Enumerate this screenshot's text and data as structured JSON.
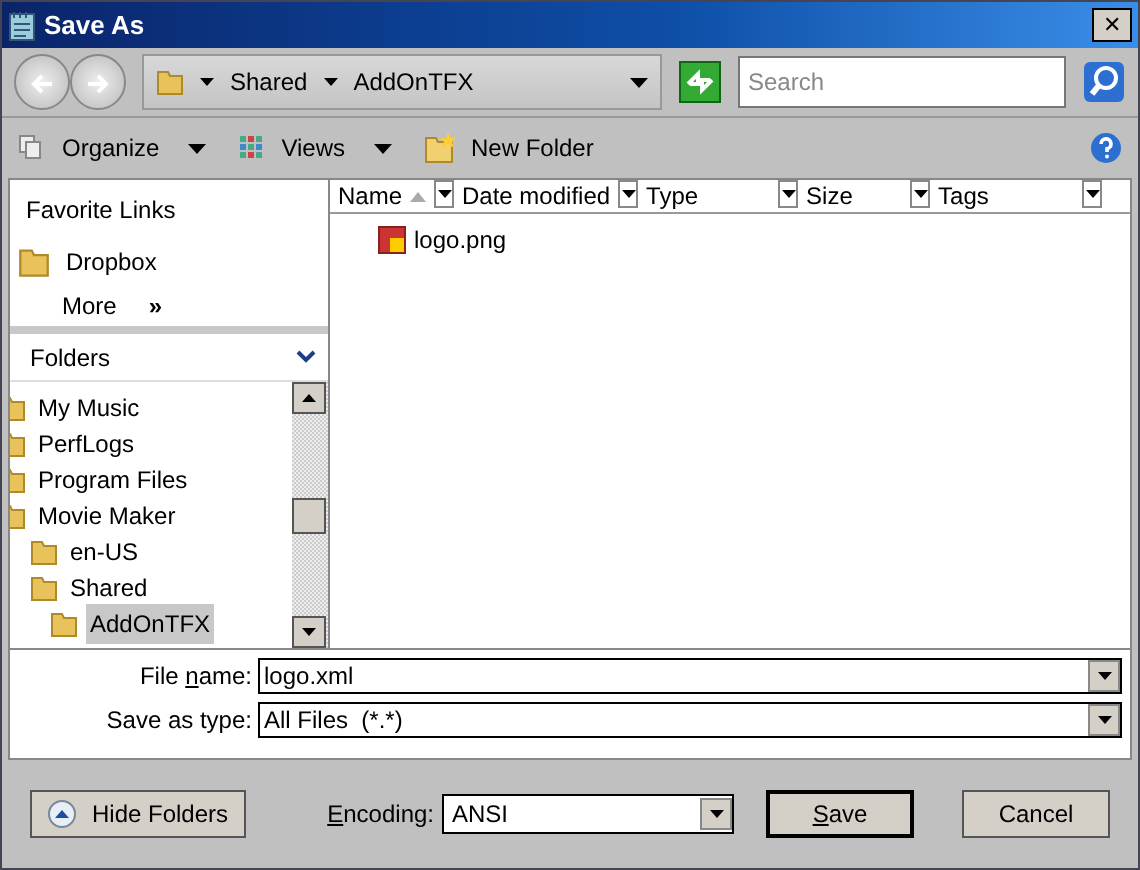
{
  "window": {
    "title": "Save As",
    "close": "✕"
  },
  "address_bar": {
    "segments": [
      "Shared",
      "AddOnTFX"
    ],
    "search": {
      "placeholder": "Search"
    }
  },
  "toolbar": {
    "items": [
      {
        "kind": "organize",
        "label": "Organize"
      },
      {
        "kind": "views",
        "label": "Views"
      },
      {
        "kind": "newfolder",
        "label": "New Folder"
      }
    ]
  },
  "favorite_links": {
    "title": "Favorite Links",
    "items": [
      {
        "label": "Dropbox"
      }
    ],
    "more": "More",
    "more_glyph": "»"
  },
  "folders": {
    "title": "Folders",
    "tree": [
      {
        "label": "My Music",
        "selected": false
      },
      {
        "label": "PerfLogs",
        "selected": false
      },
      {
        "label": "Program Files",
        "selected": false
      },
      {
        "label": "Movie Maker",
        "selected": false,
        "children": [
          {
            "label": "en-US",
            "selected": false
          },
          {
            "label": "Shared",
            "selected": false,
            "children": [
              {
                "label": "AddOnTFX",
                "selected": true
              }
            ]
          }
        ]
      }
    ]
  },
  "file_list": {
    "columns": [
      {
        "label": "Name",
        "sorted": true
      },
      {
        "label": "Date modified",
        "sorted": false
      },
      {
        "label": "Type",
        "sorted": false
      },
      {
        "label": "Size",
        "sorted": false
      },
      {
        "label": "Tags",
        "sorted": false
      }
    ],
    "files": [
      {
        "name": "logo.png"
      }
    ]
  },
  "fields": [
    {
      "label": [
        {
          "kind": "plain",
          "text": "File "
        },
        {
          "kind": "key",
          "text": "n"
        },
        {
          "kind": "plain",
          "text": "ame:"
        }
      ],
      "value": "logo.xml"
    },
    {
      "label": [
        {
          "kind": "plain",
          "text": "Save as type:"
        }
      ],
      "value": "All Files  (*.*)"
    }
  ],
  "bottom": {
    "hide_folders": "Hide Folders",
    "encoding": {
      "label": [
        {
          "kind": "key",
          "text": "E"
        },
        {
          "kind": "plain",
          "text": "ncoding:"
        }
      ],
      "value": "ANSI"
    },
    "buttons": [
      {
        "kind": "default",
        "label": [
          {
            "kind": "key",
            "text": "S"
          },
          {
            "kind": "plain",
            "text": "ave"
          }
        ]
      },
      {
        "kind": "normal",
        "label": [
          {
            "kind": "plain",
            "text": "Cancel"
          }
        ]
      }
    ]
  }
}
